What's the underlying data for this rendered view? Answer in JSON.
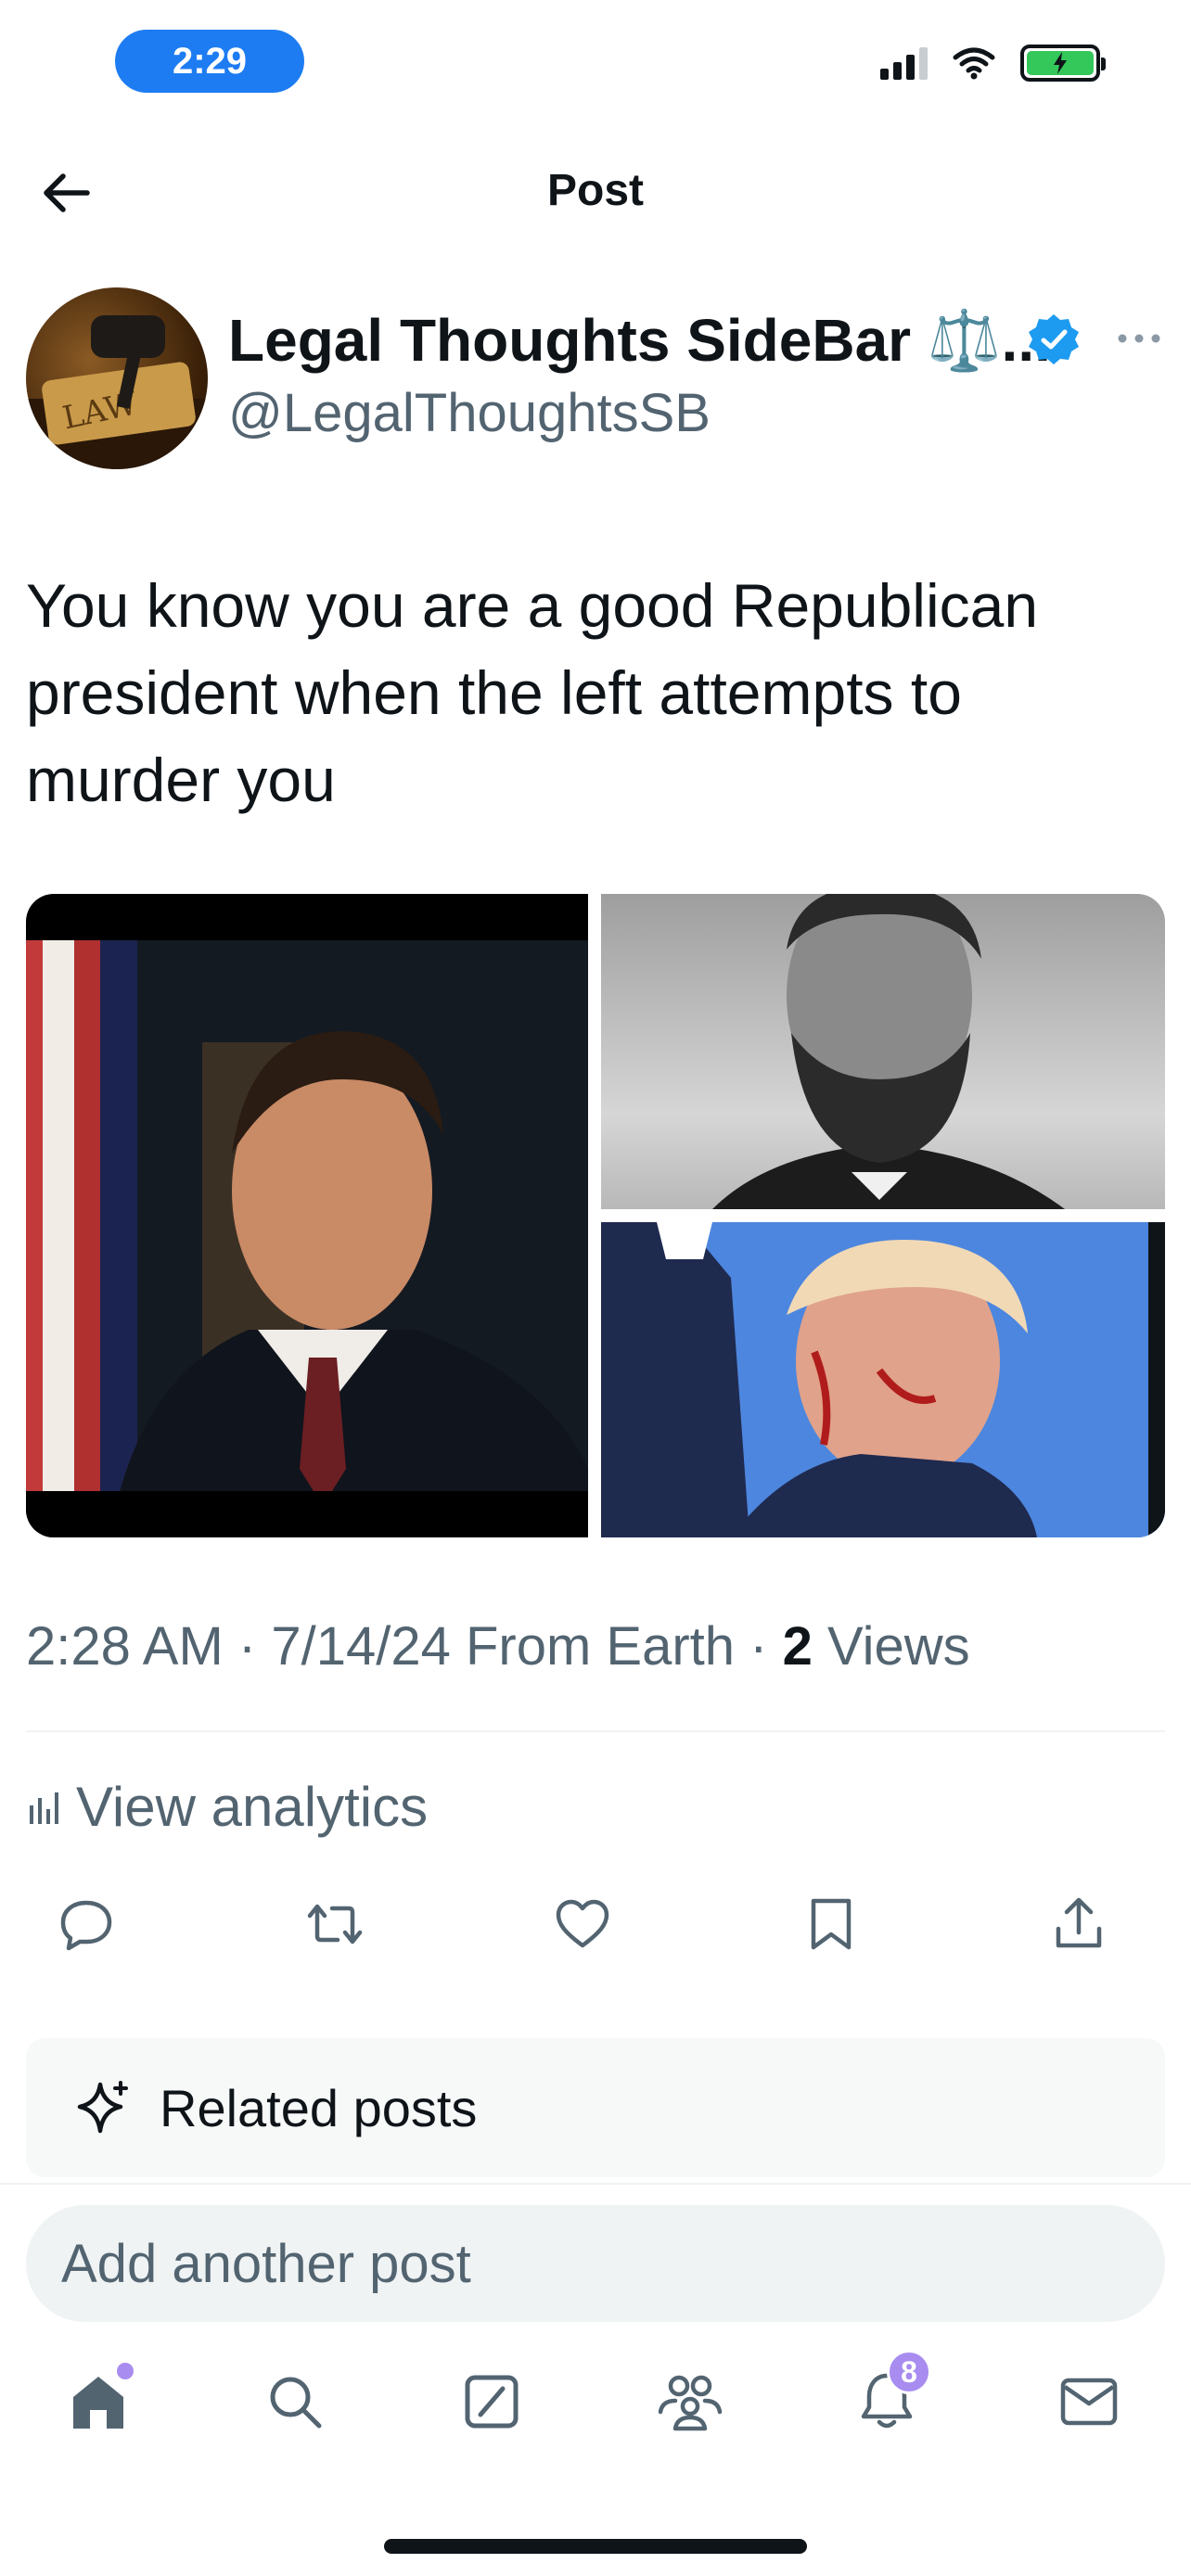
{
  "status_bar": {
    "time": "2:29"
  },
  "header": {
    "title": "Post",
    "back_icon": "arrow-left-icon"
  },
  "author": {
    "name": "Legal Thoughts SideBar ⚖️...",
    "handle": "@LegalThoughtsSB",
    "avatar_text": "LAW",
    "verified": true
  },
  "post": {
    "text": "You know you are a good Republican president when the left attempts to murder you",
    "meta_time": "2:28 AM · 7/14/24 From Earth · ",
    "views_count": "2",
    "views_label": " Views"
  },
  "analytics": {
    "label": "View analytics"
  },
  "actions": [
    "reply-icon",
    "repost-icon",
    "like-icon",
    "bookmark-icon",
    "share-icon"
  ],
  "related": {
    "label": "Related posts"
  },
  "compose": {
    "placeholder": "Add another post"
  },
  "tabbar": {
    "notifications_badge": "8"
  },
  "colors": {
    "accent": "#1d9bf0",
    "time_pill": "#1d7cf2",
    "badge": "#a88cf0",
    "muted_text": "#536471"
  }
}
